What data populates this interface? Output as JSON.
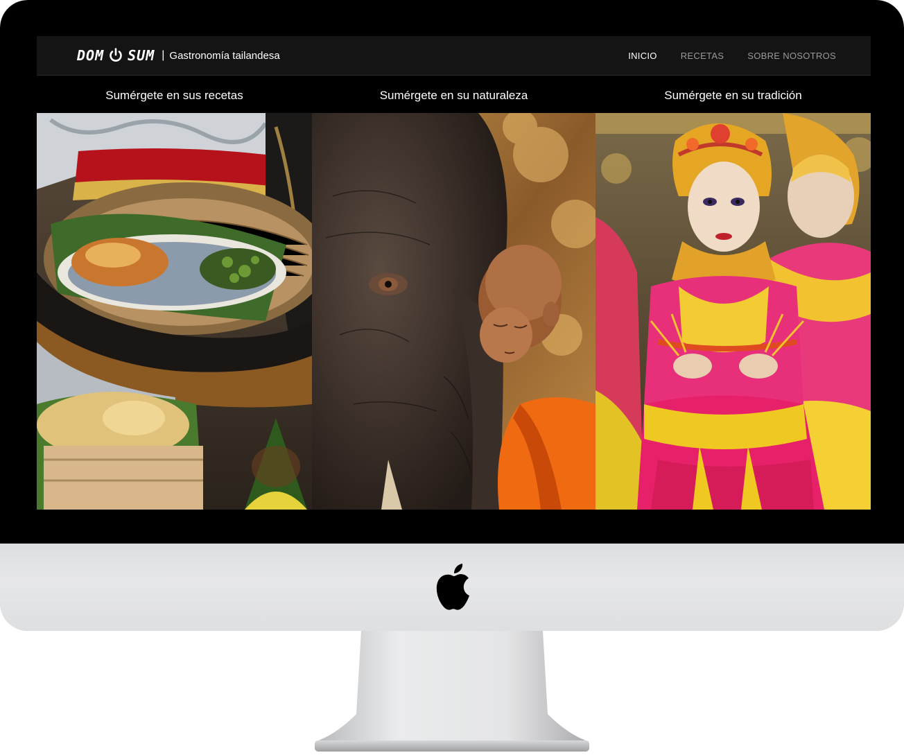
{
  "navbar": {
    "logo_left": "DOM",
    "logo_right": "SUM",
    "logo_icon": "power-icon",
    "separator": "|",
    "subtitle": "Gastronomía tailandesa",
    "links": [
      {
        "label": "INICIO",
        "active": true
      },
      {
        "label": "RECETAS",
        "active": false
      },
      {
        "label": "SOBRE NOSOTROS",
        "active": false
      }
    ]
  },
  "columns": [
    {
      "title": "Sumérgete en sus recetas",
      "image": "thai-food-photo"
    },
    {
      "title": "Sumérgete en su naturaleza",
      "image": "elephant-monk-photo"
    },
    {
      "title": "Sumérgete en su tradición",
      "image": "dancers-photo"
    }
  ],
  "colors": {
    "navbar_bg": "#141414",
    "screen_bg": "#000000",
    "nav_active": "#ffffff",
    "nav_inactive": "#9a9a9a",
    "monitor_chin": "#e4e5e6"
  },
  "device": {
    "logo": "apple-logo"
  }
}
